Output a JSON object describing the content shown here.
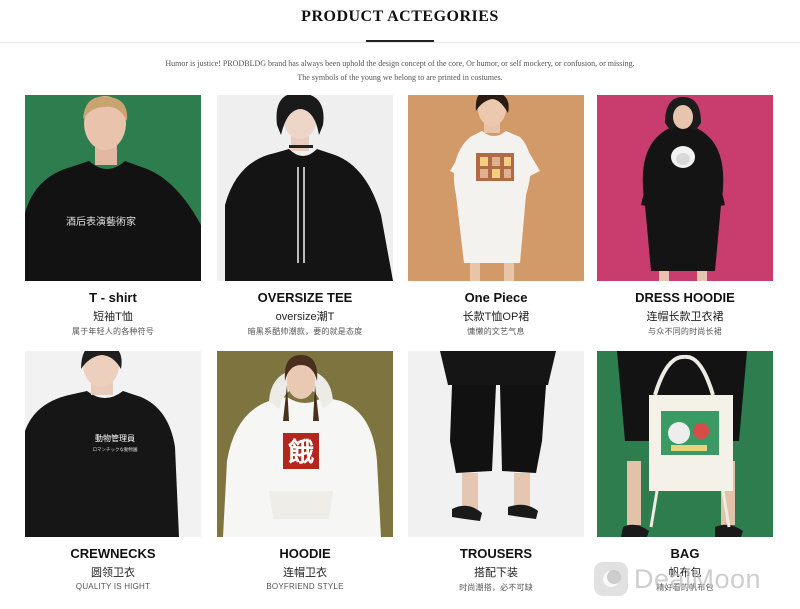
{
  "header": {
    "title": "PRODUCT ACTEGORIES",
    "intro_line1": "Humor is justice! PRODBLDG brand has always been uphold the design concept of the core, Or humor, or self mockery, or confusion, or missing.",
    "intro_line2": "The symbols of the young we belong to are printed in costumes."
  },
  "categories": [
    {
      "title": "T - shirt",
      "subtitle": "短袖T恤",
      "desc": "属于年轻人的各种符号",
      "print_text": "酒后表演藝術家"
    },
    {
      "title": "OVERSIZE TEE",
      "subtitle": "oversize潮T",
      "desc": "暗黑系酷帅潮款，要的就是态度"
    },
    {
      "title": "One Piece",
      "subtitle": "长款T恤OP裙",
      "desc": "慵懒的文艺气息"
    },
    {
      "title": "DRESS HOODIE",
      "subtitle": "连帽长款卫衣裙",
      "desc": "与众不同的时尚长裙"
    },
    {
      "title": "CREWNECKS",
      "subtitle": "圆领卫衣",
      "desc": "QUALITY IS HIGHT",
      "print_text": "動物管理員",
      "print_subtext": "ロマンチックな動物園"
    },
    {
      "title": "HOODIE",
      "subtitle": "连帽卫衣",
      "desc": "BOYFRIEND STYLE",
      "print_text": "餓"
    },
    {
      "title": "TROUSERS",
      "subtitle": "搭配下装",
      "desc": "时尚潮搭，必不可缺"
    },
    {
      "title": "BAG",
      "subtitle": "帆布包",
      "desc": "精好看的帆布包"
    }
  ],
  "watermark": {
    "text": "DealMoon",
    "icon": "dealmoon-logo-icon"
  },
  "colors": {
    "green_bg": "#2e7d4f",
    "pink_bg": "#c93d6e",
    "tan_bg": "#d29a68",
    "olive_bg": "#7d7440",
    "grey_bg": "#e6e6e6"
  }
}
